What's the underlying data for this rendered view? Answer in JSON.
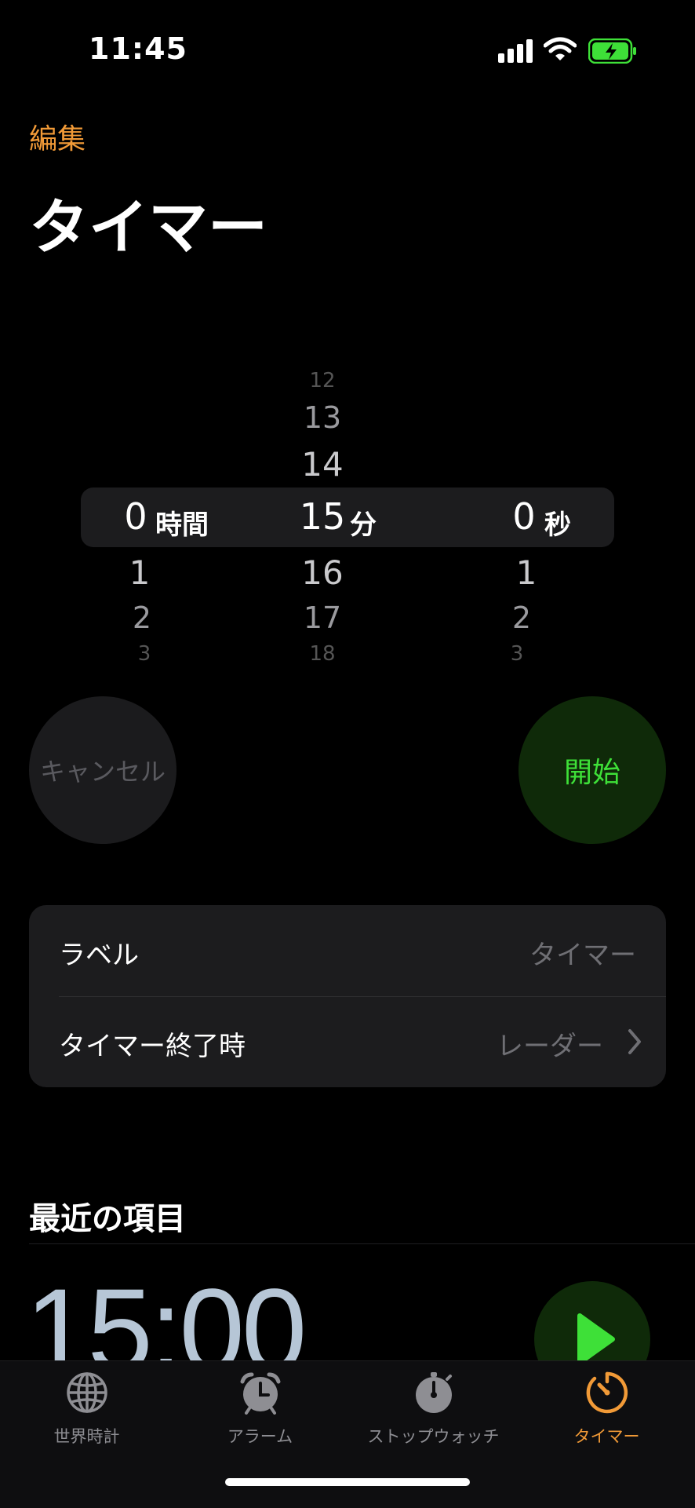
{
  "status_bar": {
    "time": "11:45",
    "icons": [
      "signal-icon",
      "wifi-icon",
      "battery-charging-icon"
    ],
    "battery_color": "#3ee038"
  },
  "header": {
    "edit": "編集",
    "title": "タイマー"
  },
  "picker": {
    "hours": {
      "selected": "0",
      "unit": "時間",
      "below": [
        "1",
        "2",
        "3"
      ]
    },
    "minutes": {
      "selected": "15",
      "unit": "分",
      "above": [
        "12",
        "13",
        "14"
      ],
      "below": [
        "16",
        "17",
        "18"
      ]
    },
    "seconds": {
      "selected": "0",
      "unit": "秒",
      "below": [
        "1",
        "2",
        "3"
      ]
    }
  },
  "buttons": {
    "cancel": "キャンセル",
    "start": "開始"
  },
  "settings": {
    "label": {
      "title": "ラベル",
      "value": "タイマー"
    },
    "on_end": {
      "title": "タイマー終了時",
      "value": "レーダー"
    }
  },
  "recent": {
    "title": "最近の項目",
    "items": [
      {
        "time": "15:00"
      }
    ]
  },
  "tabs": [
    {
      "label": "世界時計",
      "icon": "globe-icon"
    },
    {
      "label": "アラーム",
      "icon": "alarm-clock-icon"
    },
    {
      "label": "ストップウォッチ",
      "icon": "stopwatch-icon"
    },
    {
      "label": "タイマー",
      "icon": "timer-icon",
      "active": true
    }
  ],
  "colors": {
    "accent_orange": "#f19a37",
    "start_green": "#3ee038",
    "inactive_tab": "#8e8e93"
  }
}
